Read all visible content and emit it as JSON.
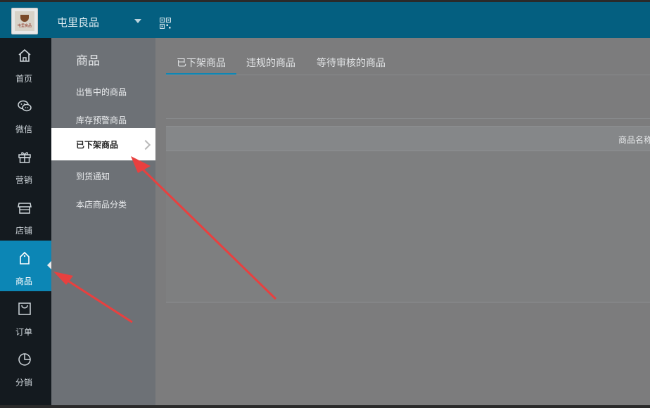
{
  "header": {
    "store_name": "屯里良品",
    "logo_text": "屯里良品",
    "dropdown_icon": "chevron-down-icon",
    "qr_icon": "qrcode-icon"
  },
  "sidebar": {
    "items": [
      {
        "label": "首页",
        "icon": "home-icon"
      },
      {
        "label": "微信",
        "icon": "wechat-icon"
      },
      {
        "label": "营销",
        "icon": "gift-icon"
      },
      {
        "label": "店铺",
        "icon": "store-icon"
      },
      {
        "label": "商品",
        "icon": "tag-icon",
        "active": true
      },
      {
        "label": "订单",
        "icon": "bag-icon"
      },
      {
        "label": "分销",
        "icon": "pie-chart-icon"
      }
    ]
  },
  "submenu": {
    "title": "商品",
    "items": [
      {
        "label": "出售中的商品"
      },
      {
        "label": "库存预警商品"
      },
      {
        "label": "已下架商品",
        "active": true
      },
      {
        "label": "到货通知"
      },
      {
        "label": "本店商品分类"
      }
    ]
  },
  "main": {
    "tabs": [
      {
        "label": "已下架商品",
        "active": true
      },
      {
        "label": "违规的商品"
      },
      {
        "label": "等待审核的商品"
      }
    ],
    "table": {
      "header_partial": "商品名称"
    }
  },
  "colors": {
    "topbar": "#045f80",
    "accent": "#0c86b5",
    "sidebar": "#141a1f",
    "arrow": "#e8403f"
  }
}
